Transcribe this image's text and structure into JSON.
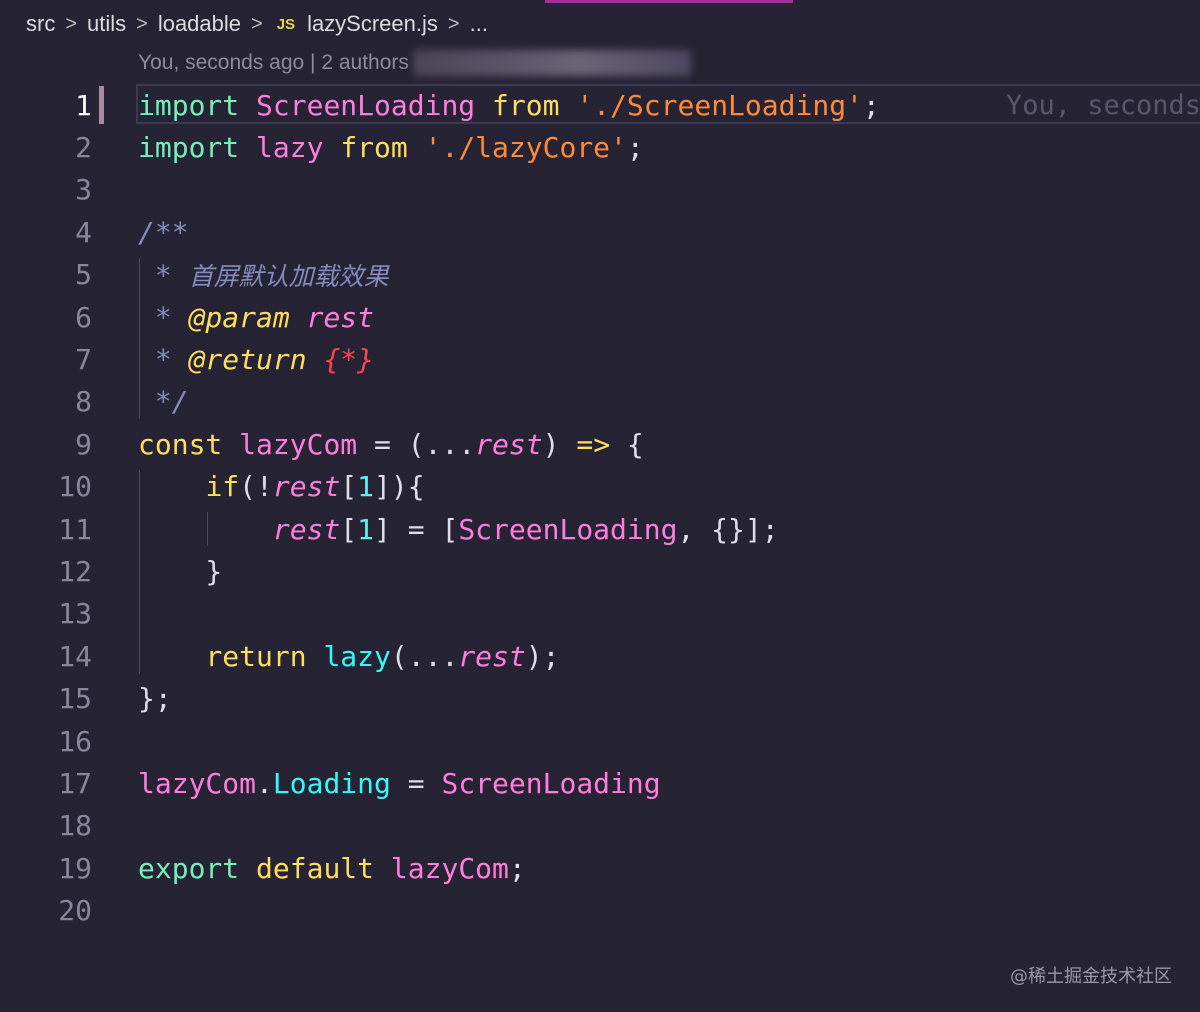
{
  "breadcrumb": {
    "items": [
      "src",
      "utils",
      "loadable"
    ],
    "file_icon": "JS",
    "file": "lazyScreen.js",
    "more": "...",
    "separator": ">"
  },
  "codelens": {
    "text": "You, seconds ago | 2 authors"
  },
  "blame": {
    "text": "You, seconds"
  },
  "lines": [
    {
      "n": "1",
      "tokens": [
        {
          "t": "import",
          "c": "kw"
        },
        {
          "t": " "
        },
        {
          "t": "ScreenLoading",
          "c": "pink"
        },
        {
          "t": " "
        },
        {
          "t": "from",
          "c": "yel"
        },
        {
          "t": " "
        },
        {
          "t": "'./ScreenLoading'",
          "c": "ora"
        },
        {
          "t": ";",
          "c": "punc"
        }
      ]
    },
    {
      "n": "2",
      "tokens": [
        {
          "t": "import",
          "c": "kw"
        },
        {
          "t": " "
        },
        {
          "t": "lazy",
          "c": "pink"
        },
        {
          "t": " "
        },
        {
          "t": "from",
          "c": "yel"
        },
        {
          "t": " "
        },
        {
          "t": "'./lazyCore'",
          "c": "ora"
        },
        {
          "t": ";",
          "c": "punc"
        }
      ]
    },
    {
      "n": "3",
      "tokens": []
    },
    {
      "n": "4",
      "tokens": [
        {
          "t": "/**",
          "c": "cmt"
        }
      ]
    },
    {
      "n": "5",
      "tokens": [
        {
          "t": " * ",
          "c": "cmt"
        },
        {
          "t": "首屏默认加载效果",
          "c": "cmt cn"
        }
      ]
    },
    {
      "n": "6",
      "tokens": [
        {
          "t": " * ",
          "c": "cmt"
        },
        {
          "t": "@param",
          "c": "cmtag"
        },
        {
          "t": " rest",
          "c": "pink ital"
        }
      ]
    },
    {
      "n": "7",
      "tokens": [
        {
          "t": " * ",
          "c": "cmt"
        },
        {
          "t": "@return",
          "c": "cmtag"
        },
        {
          "t": " "
        },
        {
          "t": "{*}",
          "c": "red"
        }
      ]
    },
    {
      "n": "8",
      "tokens": [
        {
          "t": " */",
          "c": "cmt"
        }
      ]
    },
    {
      "n": "9",
      "tokens": [
        {
          "t": "const",
          "c": "yel"
        },
        {
          "t": " "
        },
        {
          "t": "lazyCom",
          "c": "pink"
        },
        {
          "t": " = ",
          "c": "punc"
        },
        {
          "t": "(...",
          "c": "punc"
        },
        {
          "t": "rest",
          "c": "pink ital"
        },
        {
          "t": ")",
          "c": "punc"
        },
        {
          "t": " "
        },
        {
          "t": "=>",
          "c": "yel"
        },
        {
          "t": " {",
          "c": "punc"
        }
      ]
    },
    {
      "n": "10",
      "tokens": [
        {
          "t": "    "
        },
        {
          "t": "if",
          "c": "yel"
        },
        {
          "t": "(!",
          "c": "punc"
        },
        {
          "t": "rest",
          "c": "pink ital"
        },
        {
          "t": "[",
          "c": "punc"
        },
        {
          "t": "1",
          "c": "num"
        },
        {
          "t": "]){",
          "c": "punc"
        }
      ]
    },
    {
      "n": "11",
      "tokens": [
        {
          "t": "        "
        },
        {
          "t": "rest",
          "c": "pink ital"
        },
        {
          "t": "[",
          "c": "punc"
        },
        {
          "t": "1",
          "c": "num"
        },
        {
          "t": "] = [",
          "c": "punc"
        },
        {
          "t": "ScreenLoading",
          "c": "pink"
        },
        {
          "t": ", {}];",
          "c": "punc"
        }
      ]
    },
    {
      "n": "12",
      "tokens": [
        {
          "t": "    }",
          "c": "punc"
        }
      ]
    },
    {
      "n": "13",
      "tokens": []
    },
    {
      "n": "14",
      "tokens": [
        {
          "t": "    "
        },
        {
          "t": "return",
          "c": "yel"
        },
        {
          "t": " "
        },
        {
          "t": "lazy",
          "c": "cyan"
        },
        {
          "t": "(...",
          "c": "punc"
        },
        {
          "t": "rest",
          "c": "pink ital"
        },
        {
          "t": ");",
          "c": "punc"
        }
      ]
    },
    {
      "n": "15",
      "tokens": [
        {
          "t": "};",
          "c": "punc"
        }
      ]
    },
    {
      "n": "16",
      "tokens": []
    },
    {
      "n": "17",
      "tokens": [
        {
          "t": "lazyCom",
          "c": "pink"
        },
        {
          "t": ".",
          "c": "punc"
        },
        {
          "t": "Loading",
          "c": "cyan"
        },
        {
          "t": " = ",
          "c": "punc"
        },
        {
          "t": "ScreenLoading",
          "c": "pink"
        }
      ]
    },
    {
      "n": "18",
      "tokens": []
    },
    {
      "n": "19",
      "tokens": [
        {
          "t": "export",
          "c": "kw"
        },
        {
          "t": " "
        },
        {
          "t": "default",
          "c": "yel"
        },
        {
          "t": " "
        },
        {
          "t": "lazyCom",
          "c": "pink"
        },
        {
          "t": ";",
          "c": "punc"
        }
      ]
    },
    {
      "n": "20",
      "tokens": []
    }
  ],
  "watermark": "@稀土掘金技术社区"
}
